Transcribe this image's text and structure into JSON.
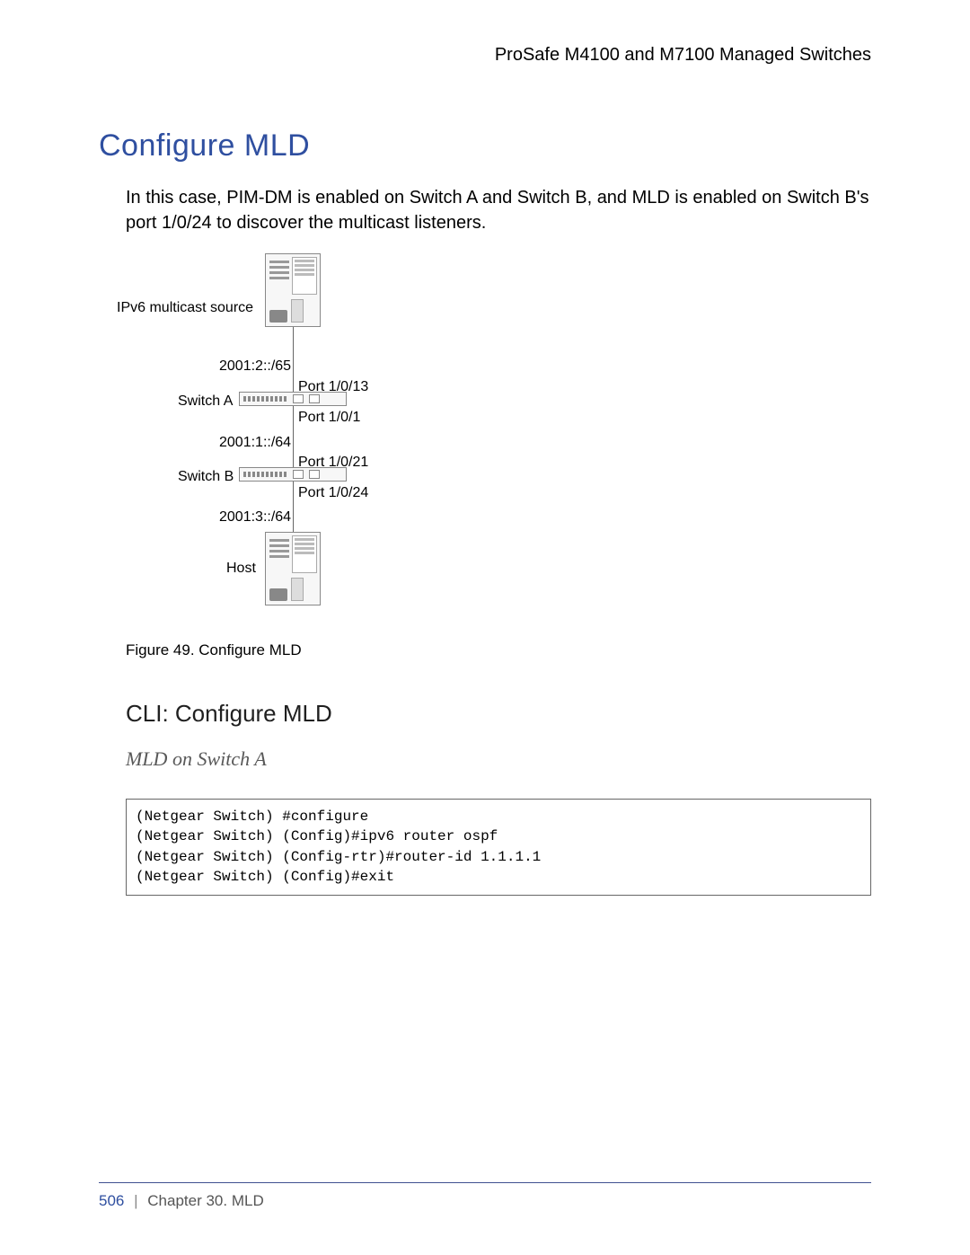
{
  "header": {
    "product_line": "ProSafe M4100 and M7100 Managed Switches"
  },
  "title": "Configure MLD",
  "intro": "In this case, PIM-DM is enabled on Switch A and Switch B, and MLD is enabled on Switch B's port 1/0/24 to discover the multicast listeners.",
  "diagram": {
    "source_label": "IPv6 multicast source",
    "switch_a_label": "Switch A",
    "switch_b_label": "Switch B",
    "host_label": "Host",
    "net1": "2001:2::/65",
    "net2": "2001:1::/64",
    "net3": "2001:3::/64",
    "port_a_up": "Port 1/0/13",
    "port_a_down": "Port 1/0/1",
    "port_b_up": "Port 1/0/21",
    "port_b_down": "Port 1/0/24",
    "caption": "Figure 49. Configure MLD"
  },
  "cli_heading": "CLI: Configure MLD",
  "cli_sub": "MLD on Switch A",
  "cli_lines": {
    "l1": "(Netgear Switch) #configure",
    "l2": "(Netgear Switch) (Config)#ipv6 router ospf",
    "l3": "(Netgear Switch) (Config-rtr)#router-id 1.1.1.1",
    "l4": "(Netgear Switch) (Config)#exit"
  },
  "footer": {
    "page": "506",
    "chapter": "Chapter 30.  MLD"
  }
}
